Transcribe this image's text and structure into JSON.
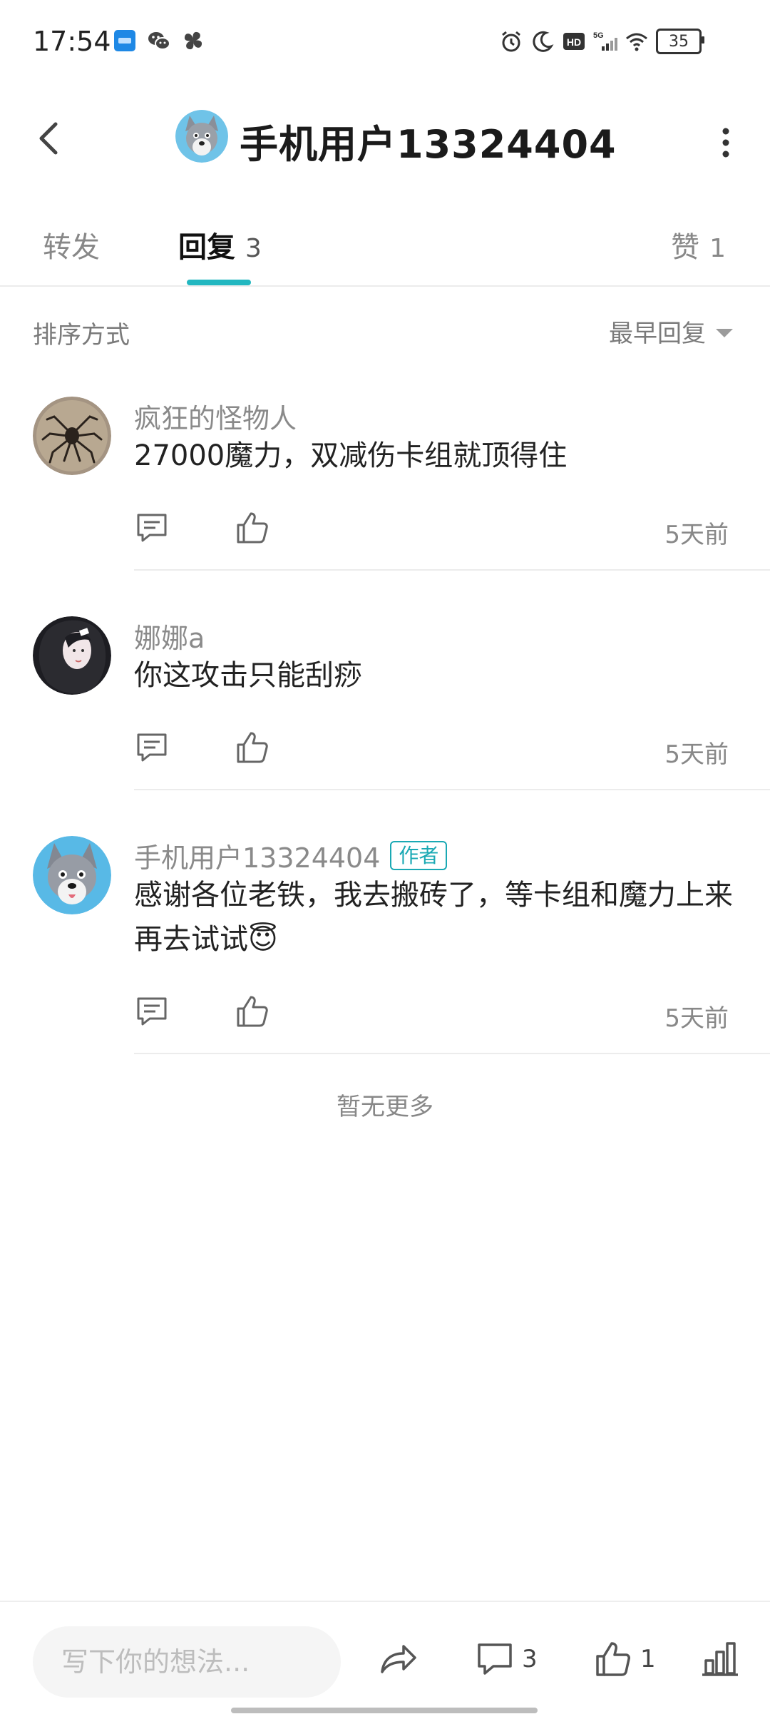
{
  "status_bar": {
    "time": "17:54",
    "battery": "35",
    "icons": [
      "blue-app-icon",
      "wechat-icon",
      "pinwheel-icon",
      "alarm-icon",
      "moon-icon",
      "hd-icon",
      "5g-signal-icon",
      "wifi-icon"
    ]
  },
  "header": {
    "title": "手机用户13324404",
    "icons": [
      "back-icon",
      "more-icon"
    ]
  },
  "tabs": {
    "forward": "转发",
    "reply": "回复",
    "reply_count": "3",
    "like": "赞",
    "like_count": "1",
    "active": "reply",
    "accent_color": "#22b7c0"
  },
  "sort": {
    "label": "排序方式",
    "value": "最早回复"
  },
  "comments": [
    {
      "username": "疯狂的怪物人",
      "text": "27000魔力，双减伤卡组就顶得住",
      "time": "5天前",
      "is_author": false
    },
    {
      "username": "娜娜a",
      "text": "你这攻击只能刮痧",
      "time": "5天前",
      "is_author": false
    },
    {
      "username": "手机用户13324404",
      "badge": "作者",
      "text": "感谢各位老铁，我去搬砖了，等卡组和魔力上来再去试试😇",
      "time": "5天前",
      "is_author": true
    }
  ],
  "no_more": "暂无更多",
  "bottom_bar": {
    "input_placeholder": "写下你的想法...",
    "comment_count": "3",
    "like_count": "1",
    "icons": [
      "share-icon",
      "comment-icon",
      "like-icon",
      "stats-icon"
    ]
  }
}
